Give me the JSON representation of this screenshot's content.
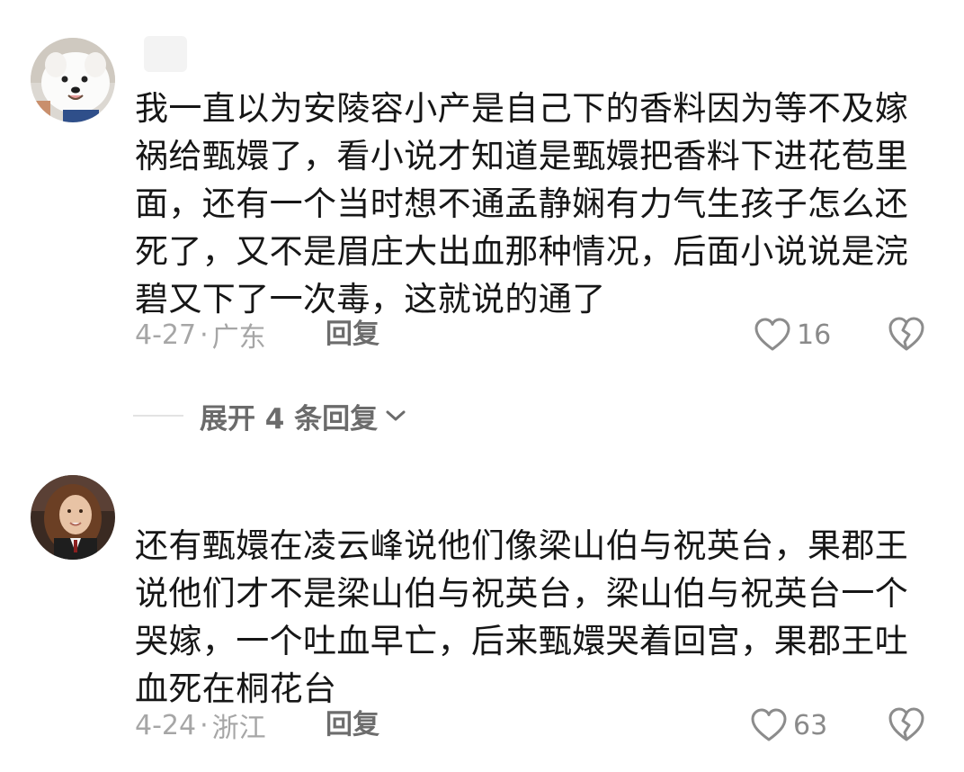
{
  "comments": [
    {
      "username": "",
      "text": "我一直以为安陵容小产是自己下的香料因为等不及嫁祸给甄嬛了，看小说才知道是甄嬛把香料下进花苞里面，还有一个当时想不通孟静娴有力气生孩子怎么还死了，又不是眉庄大出血那种情况，后面小说说是浣碧又下了一次毒，这就说的通了",
      "date": "4-27",
      "location": "广东",
      "reply_label": "回复",
      "likes": "16",
      "avatar_icon": "samoyed-dog-avatar",
      "expand_label": "展开 4 条回复"
    },
    {
      "username": "",
      "text": "还有甄嬛在凌云峰说他们像梁山伯与祝英台，果郡王说他们才不是梁山伯与祝英台，梁山伯与祝英台一个哭嫁，一个吐血早亡，后来甄嬛哭着回宫，果郡王吐血死在桐花台",
      "date": "4-24",
      "location": "浙江",
      "reply_label": "回复",
      "likes": "63",
      "avatar_icon": "girl-portrait-avatar"
    }
  ],
  "separator": "·",
  "icons": {
    "like": "heart-outline-icon",
    "dislike": "broken-heart-icon",
    "expand": "chevron-down-icon"
  },
  "colors": {
    "text": "#161616",
    "meta": "#a6a6a6",
    "reply": "#6d6d6d"
  }
}
